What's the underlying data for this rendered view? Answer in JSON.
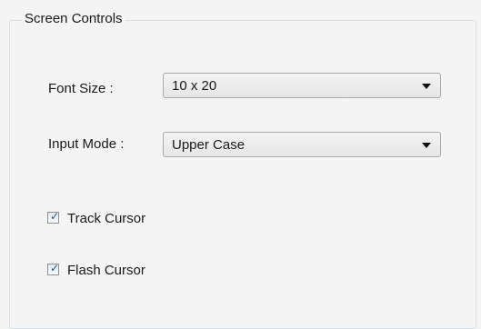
{
  "group": {
    "title": "Screen Controls"
  },
  "font_size": {
    "label": "Font Size :",
    "value": "10 x 20"
  },
  "input_mode": {
    "label": "Input Mode :",
    "value": "Upper Case"
  },
  "track_cursor": {
    "label": "Track Cursor",
    "checked": true
  },
  "flash_cursor": {
    "label": "Flash Cursor",
    "checked": true
  },
  "icons": {
    "dropdown": "chevron-down-icon",
    "check": "checkmark-icon"
  }
}
